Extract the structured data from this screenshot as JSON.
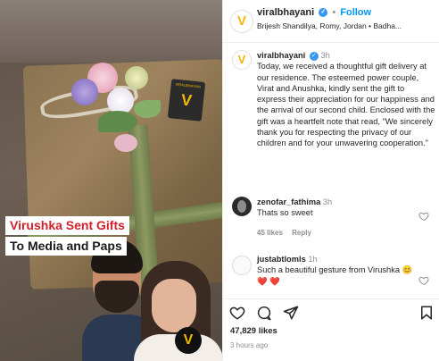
{
  "media": {
    "headline_line1_name": "Virushka",
    "headline_line1_rest": " Sent Gifts",
    "headline_line2": "To Media and Paps",
    "card_text": "VIRALBHAYANI",
    "card_logo": "V",
    "badge_logo": "V"
  },
  "header": {
    "avatar_logo": "V",
    "username": "viralbhayani",
    "separator": "•",
    "follow_label": "Follow",
    "subtitle": "Brijesh Shandilya, Romy, Jordan • Badha..."
  },
  "caption": {
    "avatar_logo": "V",
    "username": "viralbhayani",
    "time": "3h",
    "text": "Today, we received a thoughtful gift delivery at our residence. The esteemed power couple, Virat and Anushka, kindly sent the gift to express their appreciation for our happiness and the arrival of our second child. Enclosed with the gift was a heartfelt note that read, \"We sincerely thank you for respecting the privacy of our children and for your unwavering cooperation.\""
  },
  "comments": [
    {
      "username": "zenofar_fathima",
      "time": "3h",
      "text": "Thats so sweet",
      "likes": "45 likes",
      "reply": "Reply"
    },
    {
      "username": "justabtlomls",
      "time": "1h",
      "text": "Such a beautiful gesture from Virushka 😊 ❤️ ❤️"
    }
  ],
  "actions": {
    "likes": "47,829 likes",
    "ago": "3 hours ago"
  },
  "colors": {
    "accent": "#0095f6",
    "verified": "#3897f0",
    "headline_red": "#d4202b",
    "logo_yellow": "#f2b705"
  },
  "icons": [
    "verified-badge-icon",
    "heart-outline-icon",
    "comment-icon",
    "share-icon",
    "bookmark-icon"
  ]
}
